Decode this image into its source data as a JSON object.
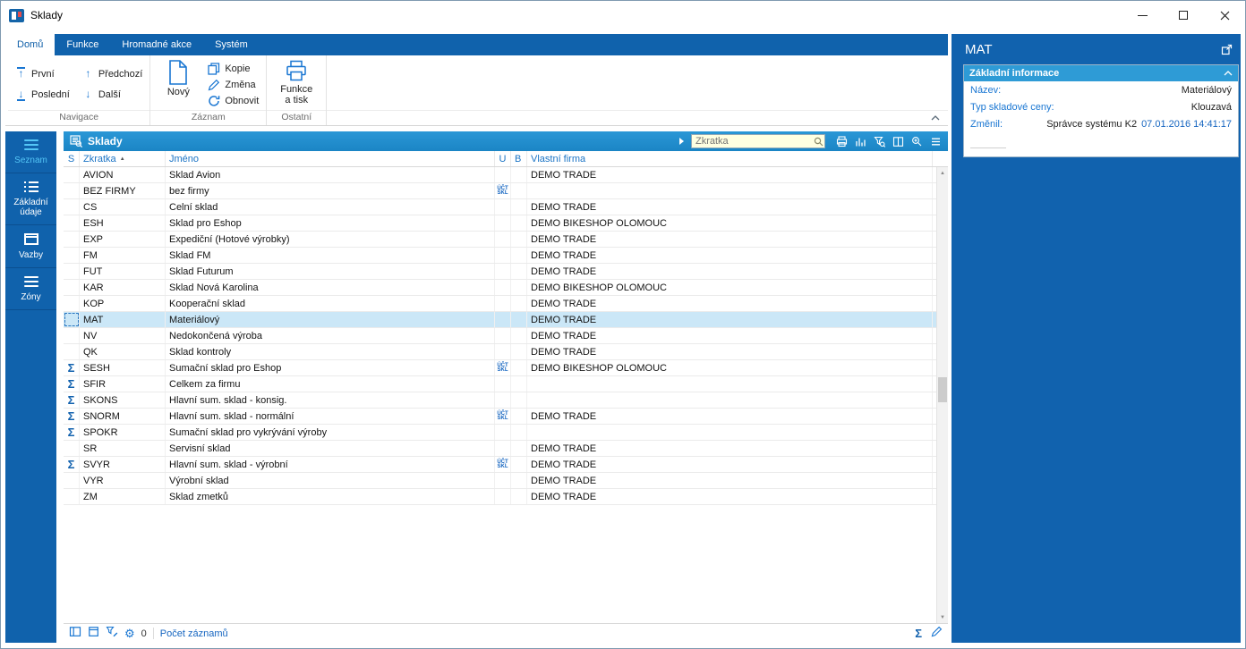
{
  "window": {
    "title": "Sklady"
  },
  "ribbon": {
    "tabs": [
      {
        "label": "Domů",
        "active": true
      },
      {
        "label": "Funkce",
        "active": false
      },
      {
        "label": "Hromadné akce",
        "active": false
      },
      {
        "label": "Systém",
        "active": false
      }
    ],
    "navigace": {
      "label": "Navigace",
      "prvni": "První",
      "posledni": "Poslední",
      "predchozi": "Předchozí",
      "dalsi": "Další"
    },
    "zaznam": {
      "label": "Záznam",
      "novy": "Nový",
      "kopie": "Kopie",
      "zmena": "Změna",
      "obnovit": "Obnovit"
    },
    "ostatni": {
      "label": "Ostatní",
      "funkce_line1": "Funkce",
      "funkce_line2": "a tisk"
    }
  },
  "sidebar": {
    "items": [
      {
        "label": "Seznam",
        "active": true,
        "icon": "menu-icon"
      },
      {
        "label": "Základní údaje",
        "active": false,
        "icon": "list-icon"
      },
      {
        "label": "Vazby",
        "active": false,
        "icon": "window-icon"
      },
      {
        "label": "Zóny",
        "active": false,
        "icon": "menu-icon"
      }
    ]
  },
  "table": {
    "title": "Sklady",
    "search": {
      "placeholder": "Zkratka"
    },
    "columns": [
      "S",
      "Zkratka",
      "Jméno",
      "U",
      "B",
      "Vlastní firma"
    ],
    "sort_column": "Zkratka",
    "uct_badge": {
      "line1": "ÚČT",
      "line2": "SKL"
    },
    "rows": [
      {
        "sum": false,
        "zkratka": "AVION",
        "jmeno": "Sklad Avion",
        "u": false,
        "firma": "DEMO TRADE"
      },
      {
        "sum": false,
        "zkratka": "BEZ FIRMY",
        "jmeno": "bez firmy",
        "u": true,
        "firma": ""
      },
      {
        "sum": false,
        "zkratka": "CS",
        "jmeno": "Celní sklad",
        "u": false,
        "firma": "DEMO TRADE"
      },
      {
        "sum": false,
        "zkratka": "ESH",
        "jmeno": "Sklad pro Eshop",
        "u": false,
        "firma": "DEMO BIKESHOP OLOMOUC"
      },
      {
        "sum": false,
        "zkratka": "EXP",
        "jmeno": "Expediční (Hotové výrobky)",
        "u": false,
        "firma": "DEMO TRADE"
      },
      {
        "sum": false,
        "zkratka": "FM",
        "jmeno": "Sklad FM",
        "u": false,
        "firma": "DEMO TRADE"
      },
      {
        "sum": false,
        "zkratka": "FUT",
        "jmeno": "Sklad Futurum",
        "u": false,
        "firma": "DEMO TRADE"
      },
      {
        "sum": false,
        "zkratka": "KAR",
        "jmeno": "Sklad Nová Karolina",
        "u": false,
        "firma": "DEMO BIKESHOP OLOMOUC"
      },
      {
        "sum": false,
        "zkratka": "KOP",
        "jmeno": "Kooperační sklad",
        "u": false,
        "firma": "DEMO TRADE"
      },
      {
        "sum": false,
        "zkratka": "MAT",
        "jmeno": "Materiálový",
        "u": false,
        "firma": "DEMO TRADE",
        "selected": true
      },
      {
        "sum": false,
        "zkratka": "NV",
        "jmeno": "Nedokončená výroba",
        "u": false,
        "firma": "DEMO TRADE"
      },
      {
        "sum": false,
        "zkratka": "QK",
        "jmeno": "Sklad kontroly",
        "u": false,
        "firma": "DEMO TRADE"
      },
      {
        "sum": true,
        "zkratka": "SESH",
        "jmeno": "Sumační sklad pro Eshop",
        "u": true,
        "firma": "DEMO BIKESHOP OLOMOUC"
      },
      {
        "sum": true,
        "zkratka": "SFIR",
        "jmeno": "Celkem za firmu",
        "u": false,
        "firma": ""
      },
      {
        "sum": true,
        "zkratka": "SKONS",
        "jmeno": "Hlavní sum. sklad - konsig.",
        "u": false,
        "firma": ""
      },
      {
        "sum": true,
        "zkratka": "SNORM",
        "jmeno": "Hlavní sum. sklad - normální",
        "u": true,
        "firma": "DEMO TRADE"
      },
      {
        "sum": true,
        "zkratka": "SPOKR",
        "jmeno": "Sumační sklad pro vykrývání výroby",
        "u": false,
        "firma": ""
      },
      {
        "sum": false,
        "zkratka": "SR",
        "jmeno": "Servisní sklad",
        "u": false,
        "firma": "DEMO TRADE"
      },
      {
        "sum": true,
        "zkratka": "SVYR",
        "jmeno": "Hlavní sum. sklad - výrobní",
        "u": true,
        "firma": "DEMO TRADE"
      },
      {
        "sum": false,
        "zkratka": "VYR",
        "jmeno": "Výrobní sklad",
        "u": false,
        "firma": "DEMO TRADE"
      },
      {
        "sum": false,
        "zkratka": "ZM",
        "jmeno": "Sklad zmetků",
        "u": false,
        "firma": "DEMO TRADE"
      }
    ]
  },
  "statusbar": {
    "gear_count": "0",
    "record_count_label": "Počet záznamů"
  },
  "detail_panel": {
    "title": "MAT",
    "section": {
      "header": "Základní informace",
      "fields": [
        {
          "label": "Název:",
          "value": "Materiálový"
        },
        {
          "label": "Typ skladové ceny:",
          "value": "Klouzavá"
        },
        {
          "label": "Změnil:",
          "value": "Správce systému K2",
          "value2": "07.01.2016 14:41:17"
        }
      ]
    }
  },
  "icons": {
    "sigma": "Σ",
    "gear": "⚙",
    "arrow_up": "↑",
    "arrow_down": "↓",
    "sort_asc": "▲",
    "scroll_up": "▲",
    "scroll_down": "▼"
  },
  "colors": {
    "ribbon_blue": "#1062AC",
    "panel_blue": "#1162AE",
    "header_blue": "#1E8FD0",
    "accent_blue": "#1976D2",
    "selected_row": "#CBE7F7",
    "search_bg": "#FFFFE1",
    "active_item_cyan": "#54C6F6"
  }
}
